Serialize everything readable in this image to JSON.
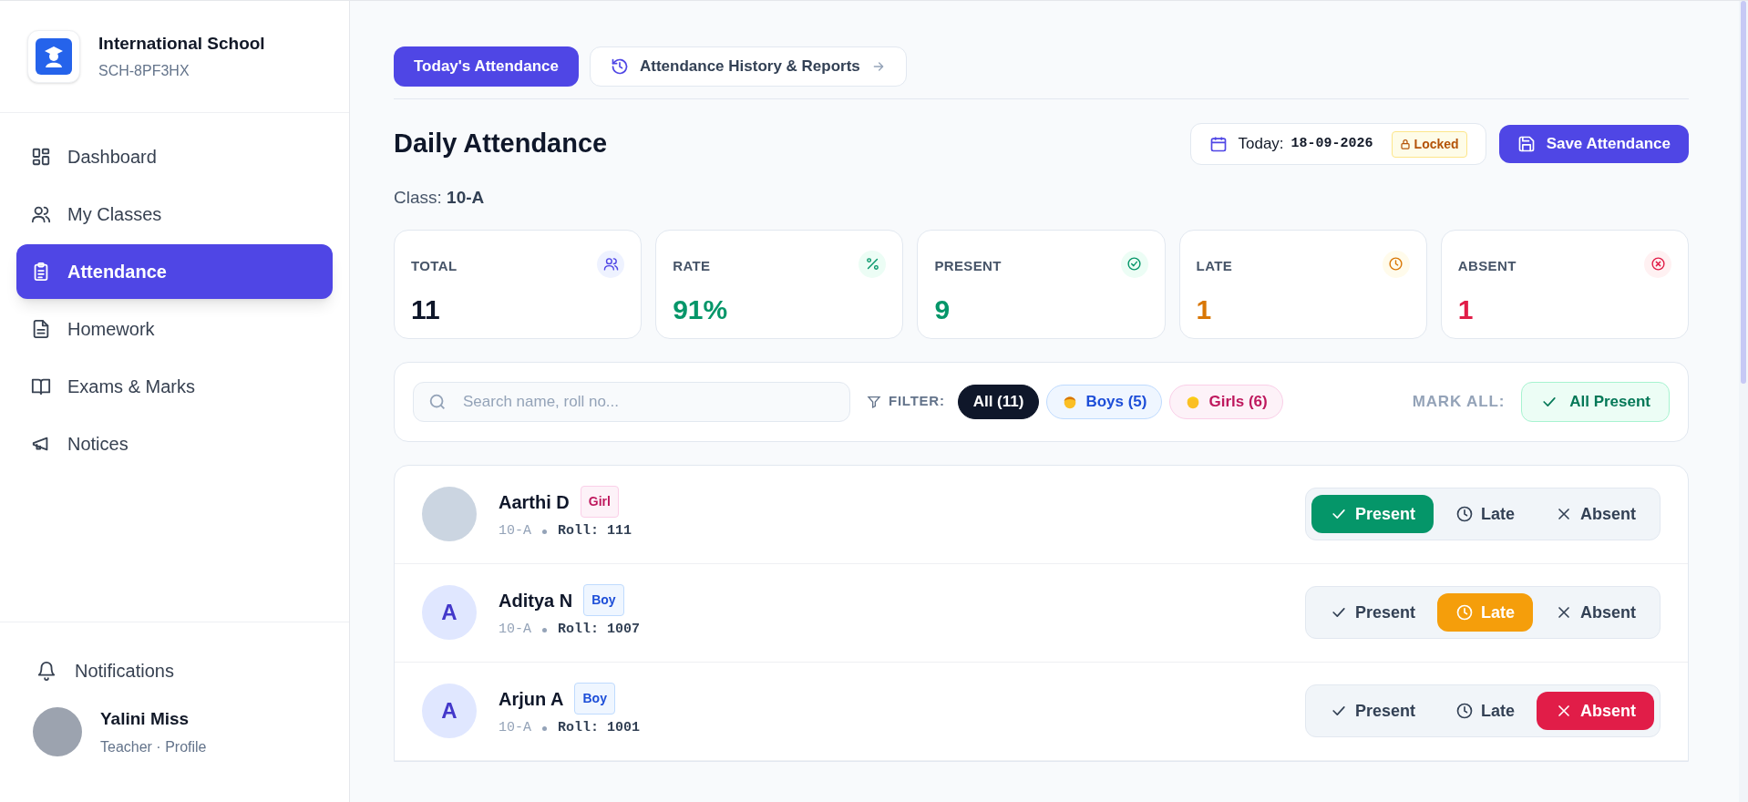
{
  "school": {
    "name": "International School",
    "code": "SCH-8PF3HX"
  },
  "nav": [
    {
      "label": "Dashboard",
      "kind": "dashboard",
      "selected": false
    },
    {
      "label": "My Classes",
      "kind": "classes",
      "selected": false
    },
    {
      "label": "Attendance",
      "kind": "attendance",
      "selected": true
    },
    {
      "label": "Homework",
      "kind": "homework",
      "selected": false
    },
    {
      "label": "Exams & Marks",
      "kind": "exams",
      "selected": false
    },
    {
      "label": "Notices",
      "kind": "notices",
      "selected": false
    }
  ],
  "notifications": "Notifications",
  "user": {
    "name": "Yalini Miss",
    "role": "Teacher · Profile"
  },
  "tabs": [
    {
      "label": "Today's Attendance",
      "selected": true
    },
    {
      "label": "Attendance History & Reports",
      "selected": false
    }
  ],
  "title": "Daily Attendance",
  "date": {
    "label": "Today:",
    "value": "18-09-2026",
    "lock": "Locked"
  },
  "save_button": "Save Attendance",
  "class_label": "Class:",
  "class_value": "10-A",
  "stats": [
    {
      "kind": "total",
      "label": "TOTAL",
      "value": "11"
    },
    {
      "kind": "rate",
      "label": "RATE",
      "value": "91%"
    },
    {
      "kind": "present",
      "label": "PRESENT",
      "value": "9"
    },
    {
      "kind": "late",
      "label": "LATE",
      "value": "1"
    },
    {
      "kind": "absent",
      "label": "ABSENT",
      "value": "1"
    }
  ],
  "search": {
    "placeholder": "Search name, roll no..."
  },
  "filter_label": "FILTER:",
  "filters": [
    {
      "kind": "all",
      "label": "All (11)",
      "selected": true
    },
    {
      "kind": "boy",
      "label": "Boys (5)",
      "selected": false
    },
    {
      "kind": "girl",
      "label": "Girls (6)",
      "selected": false
    }
  ],
  "mark_all_label": "MARK ALL:",
  "mark_all_button": "All Present",
  "students": [
    {
      "name": "Aarthi D",
      "kind": "girl",
      "tag": "Girl",
      "photo": true,
      "class": "10-A",
      "roll": "Roll: 111",
      "options": [
        {
          "kind": "present",
          "label": "Present",
          "selected": true
        },
        {
          "kind": "late",
          "label": "Late",
          "selected": false
        },
        {
          "kind": "absent",
          "label": "Absent",
          "selected": false
        }
      ]
    },
    {
      "name": "Aditya N",
      "kind": "boy",
      "tag": "Boy",
      "photo": false,
      "initial": "A",
      "class": "10-A",
      "roll": "Roll: 1007",
      "options": [
        {
          "kind": "present",
          "label": "Present",
          "selected": false
        },
        {
          "kind": "late",
          "label": "Late",
          "selected": true
        },
        {
          "kind": "absent",
          "label": "Absent",
          "selected": false
        }
      ]
    },
    {
      "name": "Arjun A",
      "kind": "boy",
      "tag": "Boy",
      "photo": false,
      "initial": "A",
      "class": "10-A",
      "roll": "Roll: 1001",
      "options": [
        {
          "kind": "present",
          "label": "Present",
          "selected": false
        },
        {
          "kind": "late",
          "label": "Late",
          "selected": false
        },
        {
          "kind": "absent",
          "label": "Absent",
          "selected": true
        }
      ]
    }
  ]
}
